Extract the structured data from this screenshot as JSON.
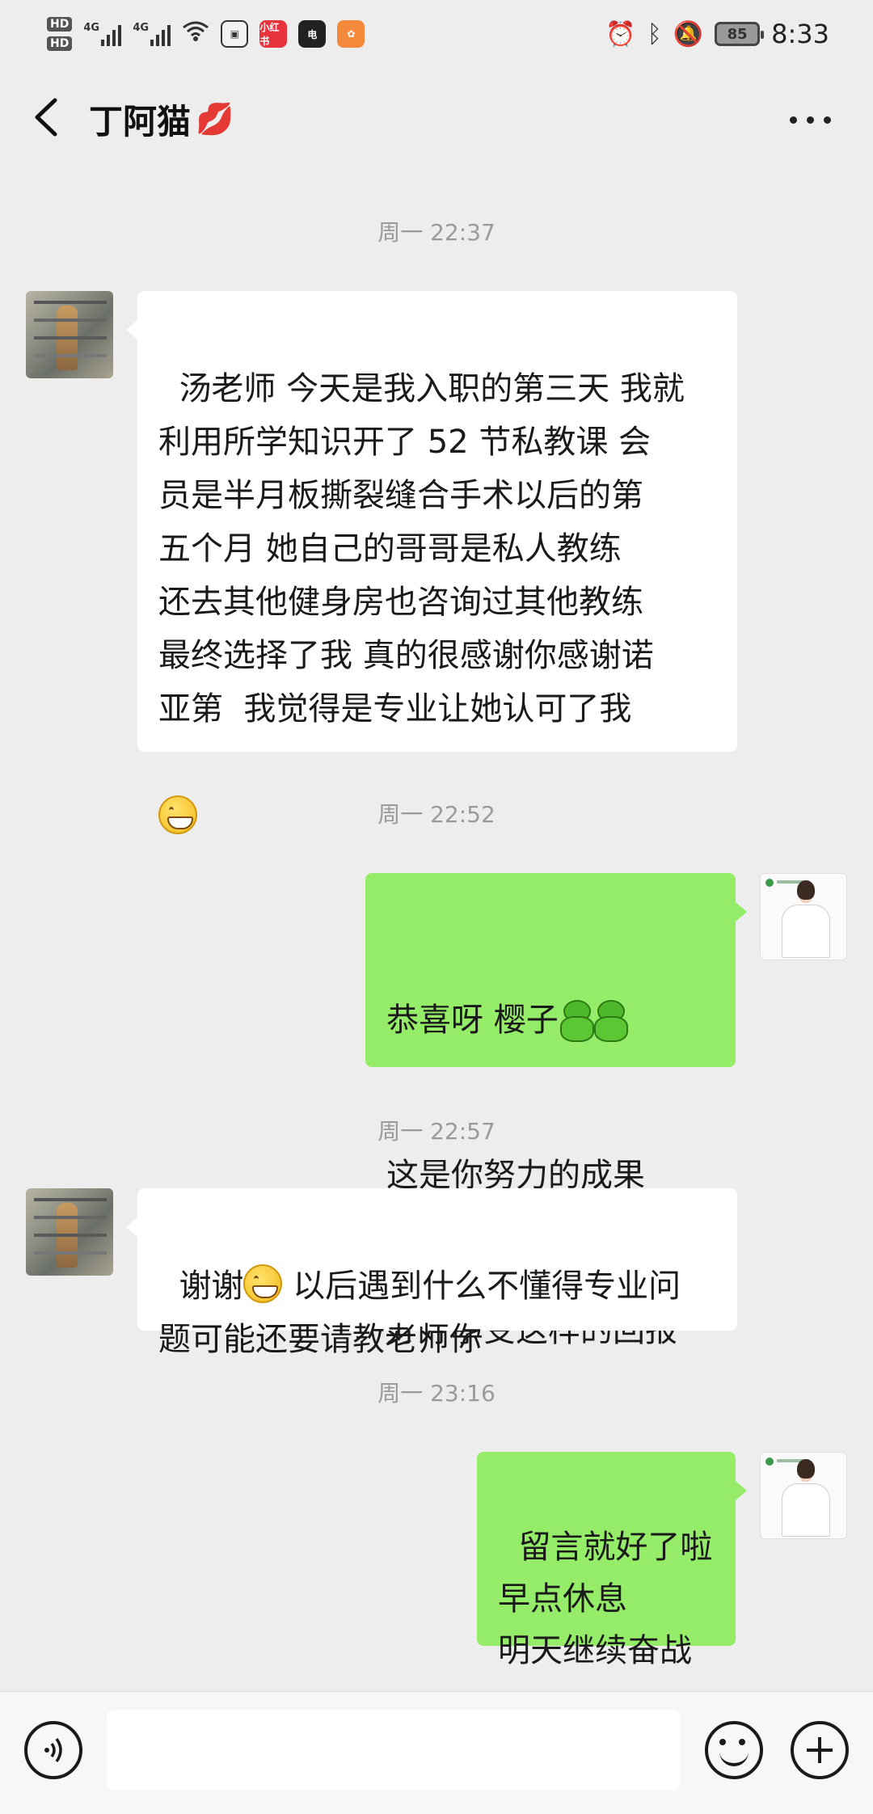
{
  "status_bar": {
    "hd1": "HD",
    "hd2": "HD",
    "sig1_tag": "4G",
    "sig2_tag": "4G",
    "app1": "小红书",
    "app2": "电",
    "battery": "85",
    "time": "8:33"
  },
  "header": {
    "title": "丁阿猫",
    "title_emoji": "💋"
  },
  "messages": [
    {
      "timestamp": "周一 22:37"
    },
    {
      "side": "left",
      "text": "汤老师 今天是我入职的第三天 我就\n利用所学知识开了 52 节私教课 会\n员是半月板撕裂缝合手术以后的第\n五个月 她自己的哥哥是私人教练\n还去其他健身房也咨询过其他教练\n最终选择了我 真的很感谢你感谢诺\n亚第  我觉得是专业让她认可了我"
    },
    {
      "timestamp": "周一 22:52"
    },
    {
      "side": "right",
      "line1": "恭喜呀 樱子",
      "line2": "这是你努力的成果",
      "line3": "好好享受这样的回报"
    },
    {
      "timestamp": "周一 22:57"
    },
    {
      "side": "left",
      "pre": "谢谢",
      "post": " 以后遇到什么不懂得专业问\n题可能还要请教老师你"
    },
    {
      "timestamp": "周一 23:16"
    },
    {
      "side": "right",
      "text": "留言就好了啦\n早点休息\n明天继续奋战"
    }
  ],
  "input_bar": {
    "placeholder": ""
  },
  "icons": {
    "back": "back-arrow-icon",
    "more": "more-dots-icon",
    "voice": "voice-icon",
    "emoji": "emoji-icon",
    "plus": "plus-icon"
  }
}
